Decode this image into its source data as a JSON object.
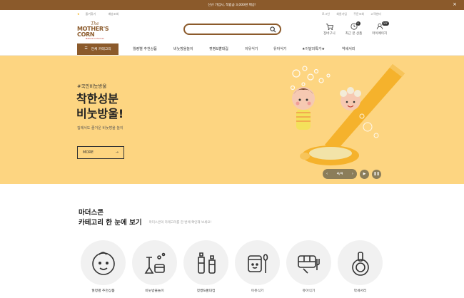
{
  "topbar": {
    "text": "신규 가입시, 적립금 3,000원 제공!",
    "close": "×"
  },
  "util": {
    "left": [
      "즐겨찾기",
      "배송조회"
    ],
    "right": [
      "로그인",
      "회원가입",
      "주문조회",
      "고객센터"
    ]
  },
  "logo": {
    "line1": "The",
    "line2": "MOTHER'S CORN",
    "line3": "Nature to Human"
  },
  "search": {
    "placeholder": ""
  },
  "header_icons": [
    {
      "label": "장바구니",
      "icon": "cart-icon"
    },
    {
      "label": "최근 본 상품",
      "icon": "clock-icon",
      "badge": "0"
    },
    {
      "label": "마이페이지",
      "icon": "user-icon",
      "badge": "OFF"
    }
  ],
  "nav": {
    "category_button": "전체 카테고리",
    "items": [
      "월령별 추천상품",
      "비눗방울놀이",
      "젖병&빨대컵",
      "이유식기",
      "유아식기",
      "★이달의특가★",
      "약세서리"
    ]
  },
  "hero": {
    "tag": "#국민비눗방울",
    "headline1": "착한성분",
    "headline2": "비눗방울!",
    "subtitle": "집에서도 즐거운 비눗방울 놀이",
    "more": "MORE",
    "pager": "4/4",
    "colors": {
      "bg": "#fdd581",
      "accent": "#f5b22c"
    }
  },
  "section": {
    "title1": "마더스콘",
    "title2": "카테고리 한 눈에 보기",
    "desc": "마더스콘의 카테고리를 한 번에 확인해 보세요!"
  },
  "categories": [
    {
      "label": "월령별 추천상품",
      "icon": "baby-face-icon"
    },
    {
      "label": "비눗방울놀이",
      "icon": "bubble-icon"
    },
    {
      "label": "젖병&빨대컵",
      "icon": "bottle-icon"
    },
    {
      "label": "이유식기",
      "icon": "food-jar-icon"
    },
    {
      "label": "유아식기",
      "icon": "plate-tray-icon"
    },
    {
      "label": "악세서리",
      "icon": "accessory-icon"
    }
  ]
}
